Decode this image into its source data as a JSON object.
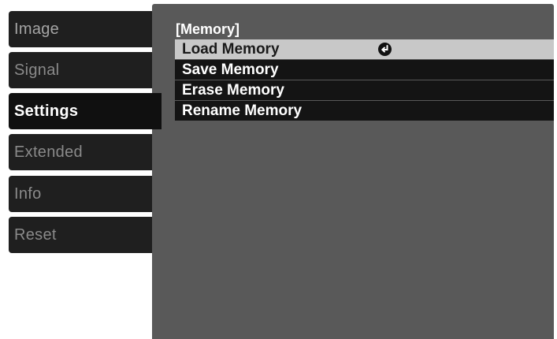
{
  "tabs": [
    {
      "label": "Image"
    },
    {
      "label": "Signal"
    },
    {
      "label": "Settings"
    },
    {
      "label": "Extended"
    },
    {
      "label": "Info"
    },
    {
      "label": "Reset"
    }
  ],
  "selected_tab": "Settings",
  "panel": {
    "title": "[Memory]",
    "items": [
      {
        "label": "Load Memory",
        "icon": "enter-icon"
      },
      {
        "label": "Save Memory"
      },
      {
        "label": "Erase Memory"
      },
      {
        "label": "Rename Memory"
      }
    ],
    "highlighted_item": "Load Memory"
  },
  "colors": {
    "panel_background": "#595959",
    "tab_background": "#1f1f1f",
    "highlight": "#c8c8c8",
    "menu_item_background": "#141414"
  }
}
